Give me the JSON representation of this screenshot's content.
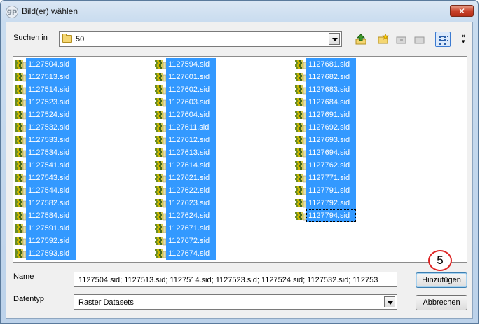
{
  "window": {
    "title": "Bild(er) wählen",
    "close_label": "✕",
    "app_icon_text": "gp"
  },
  "lookin": {
    "label": "Suchen in",
    "value": "50"
  },
  "files": {
    "col1": [
      "1127504.sid",
      "1127513.sid",
      "1127514.sid",
      "1127523.sid",
      "1127524.sid",
      "1127532.sid",
      "1127533.sid",
      "1127534.sid",
      "1127541.sid",
      "1127543.sid",
      "1127544.sid",
      "1127582.sid",
      "1127584.sid",
      "1127591.sid",
      "1127592.sid",
      "1127593.sid"
    ],
    "col2": [
      "1127594.sid",
      "1127601.sid",
      "1127602.sid",
      "1127603.sid",
      "1127604.sid",
      "1127611.sid",
      "1127612.sid",
      "1127613.sid",
      "1127614.sid",
      "1127621.sid",
      "1127622.sid",
      "1127623.sid",
      "1127624.sid",
      "1127671.sid",
      "1127672.sid",
      "1127674.sid"
    ],
    "col3": [
      "1127681.sid",
      "1127682.sid",
      "1127683.sid",
      "1127684.sid",
      "1127691.sid",
      "1127692.sid",
      "1127693.sid",
      "1127694.sid",
      "1127762.sid",
      "1127771.sid",
      "1127791.sid",
      "1127792.sid",
      "1127794.sid"
    ]
  },
  "name": {
    "label": "Name",
    "value": "1127504.sid; 1127513.sid; 1127514.sid; 1127523.sid; 1127524.sid; 1127532.sid; 112753"
  },
  "type": {
    "label": "Datentyp",
    "value": "Raster Datasets"
  },
  "buttons": {
    "add": "Hinzufügen",
    "cancel": "Abbrechen"
  },
  "annotation": {
    "number": "5",
    "color": "#dd2222"
  },
  "colors": {
    "selection": "#3399ff",
    "title_gradient": "#c9dcef"
  }
}
